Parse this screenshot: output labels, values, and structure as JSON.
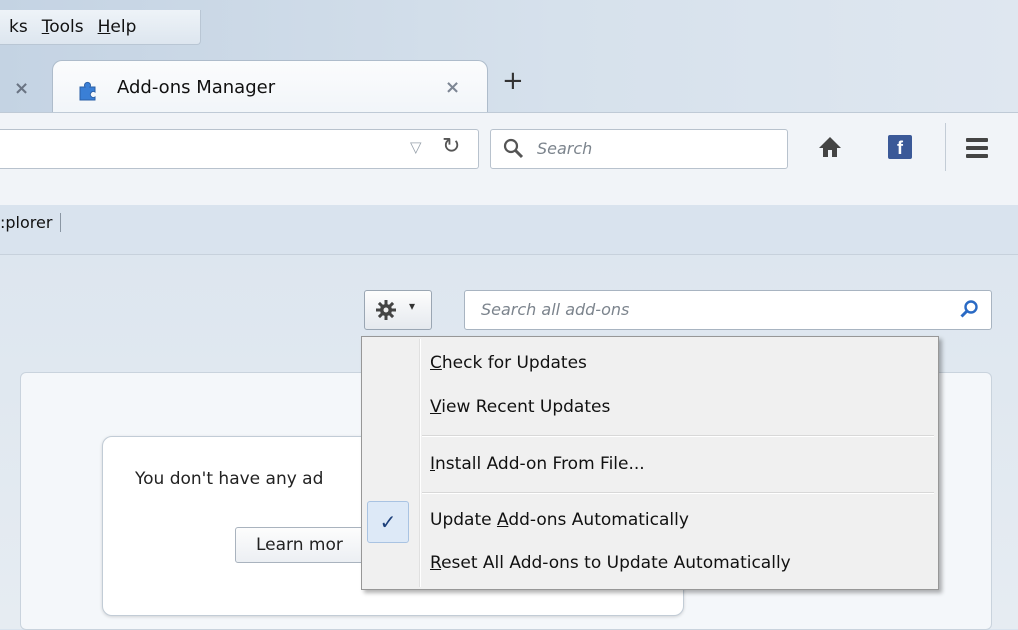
{
  "menubar": {
    "items": [
      {
        "pre": "",
        "u": "",
        "post": "ks"
      },
      {
        "pre": "",
        "u": "T",
        "post": "ools"
      },
      {
        "pre": "",
        "u": "H",
        "post": "elp"
      }
    ]
  },
  "tabs": {
    "prev_close": "×",
    "active_title": "Add-ons Manager",
    "active_close": "×",
    "new_tab": "+"
  },
  "navbar": {
    "url_dropdown": "▽",
    "reload": "↻",
    "search_placeholder": "Search"
  },
  "bookmarks": {
    "item": ":plorer"
  },
  "addons": {
    "gear_arrow": "▾",
    "search_placeholder": "Search all add-ons",
    "empty_message": "You don't have any ad",
    "learn_more": "Learn mor"
  },
  "gear_menu": {
    "items": [
      {
        "u": "C",
        "rest": "heck for Updates"
      },
      {
        "u": "V",
        "rest": "iew Recent Updates"
      },
      {
        "u": "I",
        "rest": "nstall Add-on From File..."
      },
      {
        "pre": "Update ",
        "u": "A",
        "rest": "dd-ons Automatically",
        "checked": true
      },
      {
        "u": "R",
        "rest": "eset All Add-ons to Update Automatically"
      }
    ],
    "check_mark": "✓"
  },
  "colors": {
    "accent_facebook": "#3b5998",
    "checked_bg": "#dde9f7"
  }
}
